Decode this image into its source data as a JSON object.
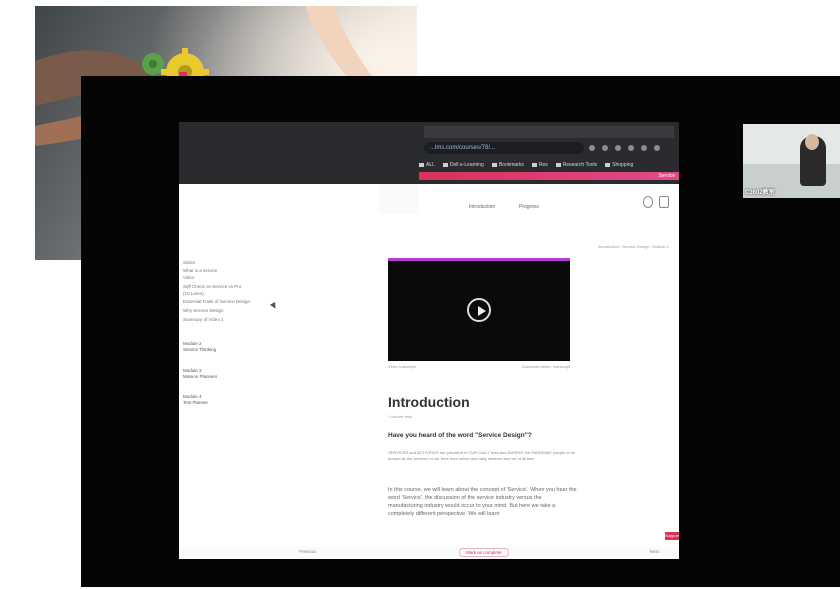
{
  "browser": {
    "url": "...lms.com/courses/78/...",
    "bookmarks": [
      "ALL",
      "Dell e-Learning",
      "Bookmarks",
      "Res",
      "Research Tools",
      "Shopping"
    ],
    "accent_bar_label": "Service"
  },
  "page_header": {
    "tab1": "Introduction",
    "tab2": "Progress"
  },
  "sidebar": {
    "items": [
      "Slides",
      "What is a service",
      "Video",
      "Self Check on Service vs Pro",
      "(10 Laren)",
      "Essential Traits of Service Design",
      "Why Service Design",
      "Summary of Video 1"
    ],
    "modules": [
      {
        "title": "Module 2",
        "sub": "Service Thinking"
      },
      {
        "title": "Module 3",
        "sub": "Mission Planners"
      },
      {
        "title": "Module 4",
        "sub": "Test Planner"
      }
    ]
  },
  "main": {
    "breadcrumb": "Introduction / Service Design / Module 1",
    "video_left": "Video transcript",
    "video_right": "Download video / transcript",
    "title": "Introduction",
    "subtitle": "1 minute read",
    "question": "Have you heard of the word \"Service Design\"?",
    "paragraph_small": "SERVICES and ACTIVITIES are prevalent in OUR DAILY lives and DURING the PANDEMIC people of all around as the services of our lives from online and daily services and we of all fare.",
    "paragraph_large": "In this course, we will learn about the concept of 'Service'. When you hear the word 'Service', the discussion of the service industry versus the manufacturing industry would occur to your mind. But here we take a completely different perspective. We will learn",
    "prev": "Previous",
    "complete": "Mark as complete",
    "next": "Next",
    "support": "Support"
  },
  "video_call": {
    "label": "C3602教室"
  },
  "icons": [
    "play-icon",
    "profile-icon",
    "bell-icon",
    "cursor-icon"
  ]
}
